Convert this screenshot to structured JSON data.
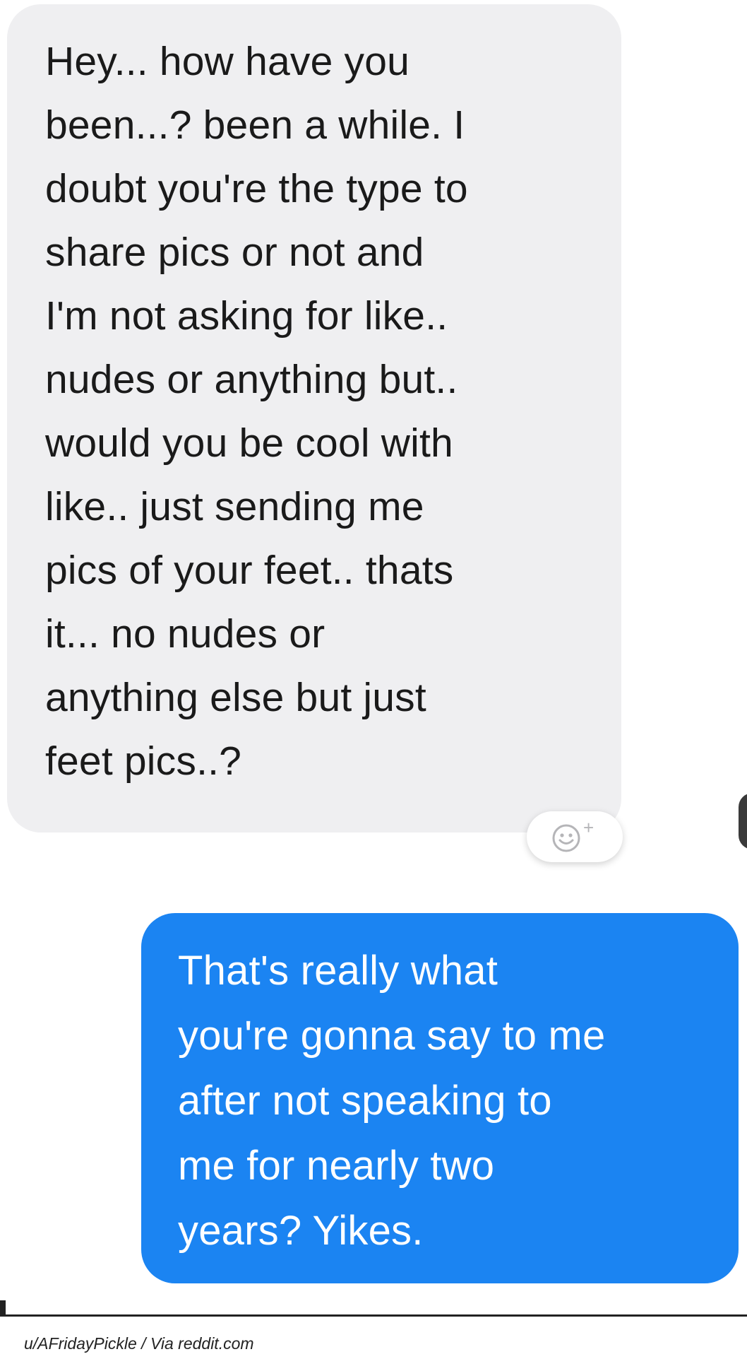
{
  "messages": {
    "incoming": {
      "text": "Hey...  how have you\nbeen...?  been a while.  I\ndoubt you're the type to\nshare pics or not and\nI'm not asking for like..\nnudes or anything but..\nwould you be cool with\nlike..  just sending me\npics of your feet..  thats\nit... no nudes or\nanything else but just\nfeet pics..?"
    },
    "reaction_button": {
      "icon": "add-reaction-icon",
      "label": "+"
    },
    "outgoing": {
      "text": "That's really what\nyou're gonna say to me\nafter not speaking to\nme for nearly two\nyears? Yikes."
    }
  },
  "footer": {
    "credit": "u/AFridayPickle / Via reddit.com"
  },
  "colors": {
    "incoming_bubble": "#efeff1",
    "outgoing_bubble": "#1b84f2",
    "incoming_text": "#1a1a1a",
    "outgoing_text": "#ffffff"
  }
}
